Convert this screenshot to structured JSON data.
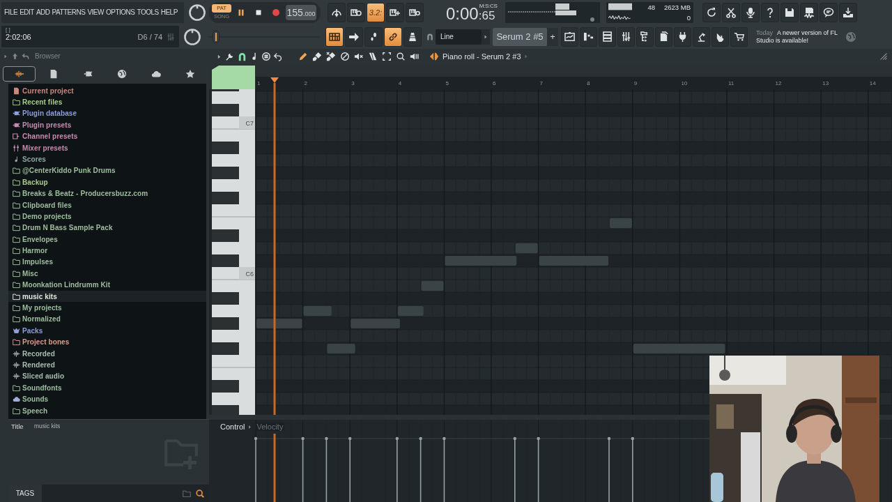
{
  "menu": [
    "FILE",
    "EDIT",
    "ADD",
    "PATTERNS",
    "VIEW",
    "OPTIONS",
    "TOOLS",
    "HELP"
  ],
  "hint": {
    "brackets": "[  ]",
    "time": "2:02:06",
    "note": "D6 / 74"
  },
  "mode": [
    {
      "label": "PAT",
      "selected": true
    },
    {
      "label": "SONG",
      "selected": false
    }
  ],
  "playing": true,
  "tempo": {
    "whole": "155",
    "fraction": ".000"
  },
  "record_tools": [
    {
      "kind": "icon",
      "on": false
    },
    {
      "kind": "icon",
      "on": false
    },
    {
      "kind": "text",
      "label": "3.2:",
      "on": true
    },
    {
      "kind": "icon",
      "on": false
    },
    {
      "kind": "icon",
      "on": false
    }
  ],
  "clock": {
    "time": "0:00",
    "centis": ":65",
    "units": "M:S:CS"
  },
  "monitor": {
    "cpu": "48",
    "memory": "2623 MB",
    "polyphony": "0"
  },
  "master_pitch": {
    "level": 0.04
  },
  "view_tools": [
    {
      "on": true
    },
    {
      "on": false
    },
    {
      "on": false
    },
    {
      "on": true
    },
    {
      "on": false
    }
  ],
  "snap": {
    "label": "Line"
  },
  "pattern": {
    "name": "Serum 2 #5",
    "add": "+"
  },
  "news": {
    "when": "Today",
    "text": "A newer version of FL Studio is available!"
  },
  "browser": {
    "title": "Browser",
    "tabs": [
      {
        "selected": true
      },
      {
        "selected": false
      },
      {
        "selected": false
      },
      {
        "selected": false
      },
      {
        "selected": false
      },
      {
        "selected": false
      }
    ],
    "items": [
      {
        "label": "Current project",
        "kind": "project",
        "color": "#c98a7e",
        "selected": false
      },
      {
        "label": "Recent files",
        "kind": "folder",
        "color": "#a9cc8e",
        "selected": false
      },
      {
        "label": "Plugin database",
        "kind": "plugin",
        "color": "#8f9fd8",
        "selected": false
      },
      {
        "label": "Plugin presets",
        "kind": "plugin",
        "color": "#c98bb2",
        "selected": false
      },
      {
        "label": "Channel presets",
        "kind": "channel",
        "color": "#c98bb2",
        "selected": false
      },
      {
        "label": "Mixer presets",
        "kind": "mixer",
        "color": "#c98bb2",
        "selected": false
      },
      {
        "label": "Scores",
        "kind": "note",
        "color": "#8fa8a2",
        "selected": false
      },
      {
        "label": "@CenterKiddo Punk Drums",
        "kind": "folder",
        "color": "#9fbfa0",
        "selected": false
      },
      {
        "label": "Backup",
        "kind": "folder",
        "color": "#a9cc8e",
        "selected": false
      },
      {
        "label": "Breaks & Beatz - Producersbuzz.com",
        "kind": "folder",
        "color": "#9fbfa0",
        "selected": false
      },
      {
        "label": "Clipboard files",
        "kind": "folder",
        "color": "#9fbfa0",
        "selected": false
      },
      {
        "label": "Demo projects",
        "kind": "folder",
        "color": "#9fbfa0",
        "selected": false
      },
      {
        "label": "Drum N Bass Sample Pack",
        "kind": "folder",
        "color": "#9fbfa0",
        "selected": false
      },
      {
        "label": "Envelopes",
        "kind": "folder",
        "color": "#9fbfa0",
        "selected": false
      },
      {
        "label": "Harmor",
        "kind": "folder",
        "color": "#9fbfa0",
        "selected": false
      },
      {
        "label": "Impulses",
        "kind": "folder",
        "color": "#9fbfa0",
        "selected": false
      },
      {
        "label": "Misc",
        "kind": "folder",
        "color": "#9fbfa0",
        "selected": false
      },
      {
        "label": "Moonkation Lindrumm Kit",
        "kind": "folder",
        "color": "#9fbfa0",
        "selected": false
      },
      {
        "label": "music kits",
        "kind": "folder",
        "color": "#e2ebe2",
        "selected": true
      },
      {
        "label": "My projects",
        "kind": "folder",
        "color": "#9fbfa0",
        "selected": false
      },
      {
        "label": "Normalized",
        "kind": "folder",
        "color": "#9fbfa0",
        "selected": false
      },
      {
        "label": "Packs",
        "kind": "packs",
        "color": "#8f9fd8",
        "selected": false
      },
      {
        "label": "Project bones",
        "kind": "folder",
        "color": "#d99c8c",
        "selected": false
      },
      {
        "label": "Recorded",
        "kind": "audio",
        "color": "#a9bfb2",
        "selected": false
      },
      {
        "label": "Rendered",
        "kind": "audio",
        "color": "#a9bfb2",
        "selected": false
      },
      {
        "label": "Sliced audio",
        "kind": "audio",
        "color": "#a9bfb2",
        "selected": false
      },
      {
        "label": "Soundfonts",
        "kind": "folder",
        "color": "#9fbfa0",
        "selected": false
      },
      {
        "label": "Sounds",
        "kind": "cloud",
        "color": "#9fbfa0",
        "selected": false
      },
      {
        "label": "Speech",
        "kind": "folder",
        "color": "#9fbfa0",
        "selected": false
      }
    ]
  },
  "info": {
    "key": "Title",
    "value": "music kits",
    "tags": "TAGS"
  },
  "piano_roll": {
    "title": "Piano roll - Serum 2 #3",
    "magnet": {
      "on": true
    },
    "edit_tools": [
      {
        "selected": true
      },
      {
        "selected": false
      },
      {
        "selected": false
      },
      {
        "selected": false
      },
      {
        "selected": false
      },
      {
        "selected": false
      },
      {
        "selected": false
      },
      {
        "selected": false
      },
      {
        "selected": false
      }
    ],
    "bars": [
      "1",
      "2",
      "3",
      "4",
      "5",
      "6",
      "7",
      "8",
      "9",
      "10",
      "11",
      "12",
      "13",
      "14"
    ],
    "octaves": [
      "C7",
      "C6"
    ]
  },
  "control": {
    "label": "Control",
    "target": "Velocity"
  }
}
